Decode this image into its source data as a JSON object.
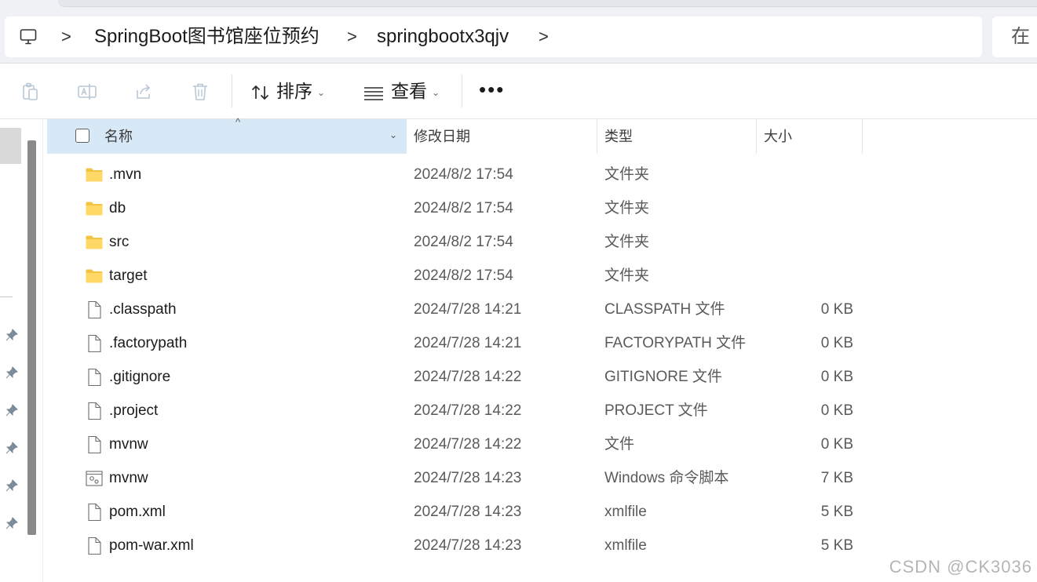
{
  "breadcrumb": {
    "items": [
      "SpringBoot图书馆座位预约",
      "springbootx3qjv"
    ],
    "separator": ">"
  },
  "search": {
    "label": "在"
  },
  "toolbar": {
    "sort_label": "排序",
    "view_label": "查看"
  },
  "columns": {
    "name": "名称",
    "date": "修改日期",
    "type": "类型",
    "size": "大小"
  },
  "files": [
    {
      "name": ".mvn",
      "date": "2024/8/2 17:54",
      "type": "文件夹",
      "size": "",
      "icon": "folder-icon"
    },
    {
      "name": "db",
      "date": "2024/8/2 17:54",
      "type": "文件夹",
      "size": "",
      "icon": "folder-icon"
    },
    {
      "name": "src",
      "date": "2024/8/2 17:54",
      "type": "文件夹",
      "size": "",
      "icon": "folder-icon"
    },
    {
      "name": "target",
      "date": "2024/8/2 17:54",
      "type": "文件夹",
      "size": "",
      "icon": "folder-icon"
    },
    {
      "name": ".classpath",
      "date": "2024/7/28 14:21",
      "type": "CLASSPATH 文件",
      "size": "0 KB",
      "icon": "file-icon"
    },
    {
      "name": ".factorypath",
      "date": "2024/7/28 14:21",
      "type": "FACTORYPATH 文件",
      "size": "0 KB",
      "icon": "file-icon"
    },
    {
      "name": ".gitignore",
      "date": "2024/7/28 14:22",
      "type": "GITIGNORE 文件",
      "size": "0 KB",
      "icon": "file-icon"
    },
    {
      "name": ".project",
      "date": "2024/7/28 14:22",
      "type": "PROJECT 文件",
      "size": "0 KB",
      "icon": "file-icon"
    },
    {
      "name": "mvnw",
      "date": "2024/7/28 14:22",
      "type": "文件",
      "size": "0 KB",
      "icon": "file-icon"
    },
    {
      "name": "mvnw",
      "date": "2024/7/28 14:23",
      "type": "Windows 命令脚本",
      "size": "7 KB",
      "icon": "script-icon"
    },
    {
      "name": "pom.xml",
      "date": "2024/7/28 14:23",
      "type": "xmlfile",
      "size": "5 KB",
      "icon": "file-icon"
    },
    {
      "name": "pom-war.xml",
      "date": "2024/7/28 14:23",
      "type": "xmlfile",
      "size": "5 KB",
      "icon": "file-icon"
    }
  ],
  "watermark": "CSDN @CK3036",
  "colors": {
    "header_selected": "#d7e9f7",
    "folder": "#f3c441",
    "text_secondary": "#5a5a5a"
  }
}
